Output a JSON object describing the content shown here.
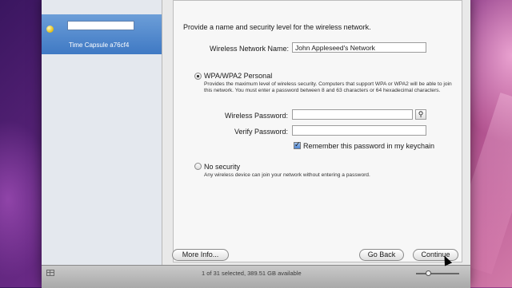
{
  "sidebar": {
    "device_name": "Time Capsule a76cf4",
    "rename_value": ""
  },
  "pane": {
    "intro": "Provide a name and security level for the wireless network.",
    "network_name_label": "Wireless Network Name:",
    "network_name_value": "John Appleseed's Network",
    "wpa": {
      "title": "WPA/WPA2 Personal",
      "selected": true,
      "description": "Provides the maximum level of wireless security. Computers that support WPA or WPA2 will be able to join this network. You must enter a password between 8 and 63 characters or 64 hexadecimal characters."
    },
    "password_label": "Wireless Password:",
    "password_value": "",
    "verify_label": "Verify Password:",
    "verify_value": "",
    "key_icon": "key-icon",
    "remember_label": "Remember this password in my keychain",
    "remember_checked": true,
    "no_security": {
      "title": "No security",
      "selected": false,
      "description": "Any wireless device can join your network without entering a password."
    }
  },
  "buttons": {
    "more_info": "More Info...",
    "go_back": "Go Back",
    "continue": "Continue"
  },
  "statusbar": {
    "text": "1 of 31 selected, 389.51 GB available"
  }
}
